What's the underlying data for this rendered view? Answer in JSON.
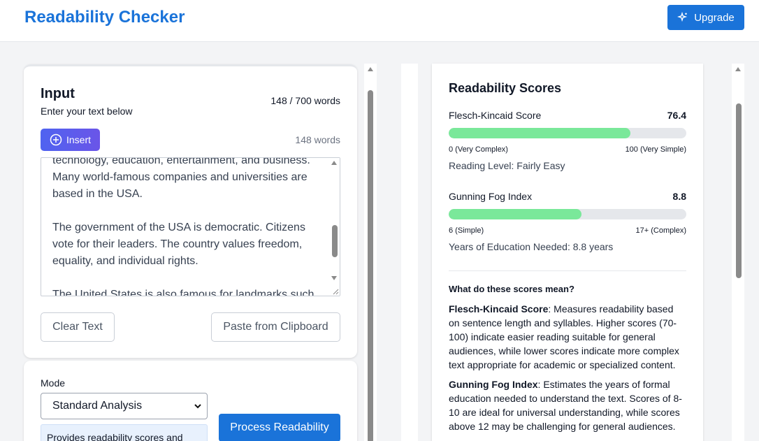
{
  "header": {
    "title": "Readability Checker",
    "upgrade_label": "Upgrade"
  },
  "input": {
    "title": "Input",
    "subtitle": "Enter your text below",
    "word_limit": "148 / 700 words",
    "insert_label": "Insert",
    "word_count": "148 words",
    "text_paragraphs": [
      "technology, education, entertainment, and business. Many world-famous companies and universities are based in the USA.",
      "The government of the USA is democratic. Citizens vote for their leaders. The country values freedom, equality, and individual rights.",
      "The United States is also famous for landmarks such"
    ],
    "clear_label": "Clear Text",
    "paste_label": "Paste from Clipboard"
  },
  "mode": {
    "label": "Mode",
    "selected": "Standard Analysis",
    "description": "Provides readability scores and",
    "process_label": "Process Readability"
  },
  "scores": {
    "title": "Readability Scores",
    "flesch": {
      "label": "Flesch-Kincaid Score",
      "value": "76.4",
      "fill_percent": 76.4,
      "scale_min": "0 (Very Complex)",
      "scale_max": "100 (Very Simple)",
      "note": "Reading Level: Fairly Easy"
    },
    "fog": {
      "label": "Gunning Fog Index",
      "value": "8.8",
      "fill_percent": 56,
      "scale_min": "6 (Simple)",
      "scale_max": "17+ (Complex)",
      "note": "Years of Education Needed: 8.8 years"
    },
    "explain_title": "What do these scores mean?",
    "flesch_term": "Flesch-Kincaid Score",
    "flesch_desc": ": Measures readability based on sentence length and syllables. Higher scores (70-100) indicate easier reading suitable for general audiences, while lower scores indicate more complex text appropriate for academic or specialized content.",
    "fog_term": "Gunning Fog Index",
    "fog_desc": ": Estimates the years of formal education needed to understand the text. Scores of 8-10 are ideal for universal understanding, while scores above 12 may be challenging for general audiences."
  },
  "colors": {
    "brand": "#1a73d9",
    "bar_fill": "#7ae89a",
    "bar_track": "#e5e7eb"
  },
  "icons": {
    "upgrade": "sparkle-icon",
    "insert": "plus-circle-icon"
  }
}
